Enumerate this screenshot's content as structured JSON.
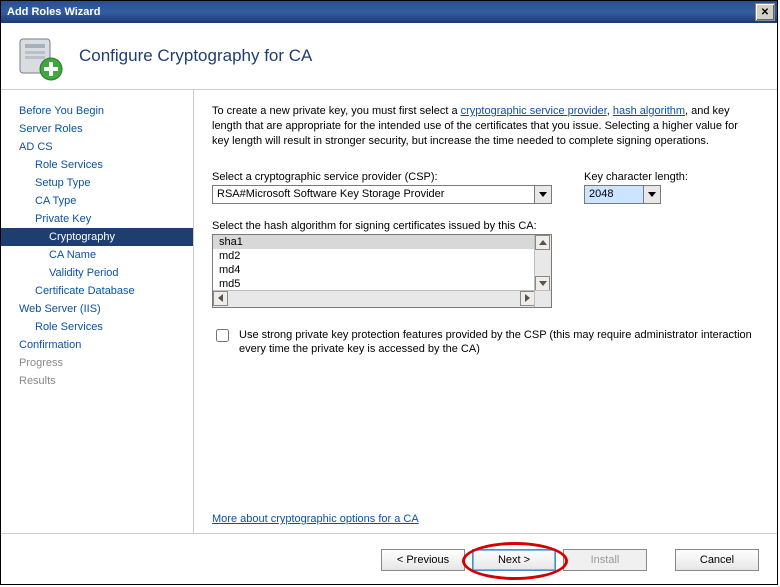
{
  "title": "Add Roles Wizard",
  "header": "Configure Cryptography for CA",
  "intro": {
    "p1a": "To create a new private key, you must first select a ",
    "link1": "cryptographic service provider",
    "p1b": ", ",
    "link2": "hash algorithm",
    "p1c": ", and key length that are appropriate for the intended use of the certificates that you issue. Selecting a higher value for key length will result in stronger security, but increase the time needed to complete signing operations."
  },
  "sidebar": [
    {
      "label": "Before You Begin",
      "cls": ""
    },
    {
      "label": "Server Roles",
      "cls": ""
    },
    {
      "label": "AD CS",
      "cls": ""
    },
    {
      "label": "Role Services",
      "cls": "sub"
    },
    {
      "label": "Setup Type",
      "cls": "sub"
    },
    {
      "label": "CA Type",
      "cls": "sub"
    },
    {
      "label": "Private Key",
      "cls": "sub"
    },
    {
      "label": "Cryptography",
      "cls": "subsub sel"
    },
    {
      "label": "CA Name",
      "cls": "subsub"
    },
    {
      "label": "Validity Period",
      "cls": "subsub"
    },
    {
      "label": "Certificate Database",
      "cls": "sub"
    },
    {
      "label": "Web Server (IIS)",
      "cls": ""
    },
    {
      "label": "Role Services",
      "cls": "sub"
    },
    {
      "label": "Confirmation",
      "cls": ""
    },
    {
      "label": "Progress",
      "cls": "dis"
    },
    {
      "label": "Results",
      "cls": "dis"
    }
  ],
  "csp": {
    "label": "Select a cryptographic service provider (CSP):",
    "value": "RSA#Microsoft Software Key Storage Provider"
  },
  "keylen": {
    "label": "Key character length:",
    "value": "2048"
  },
  "hash": {
    "label": "Select the hash algorithm for signing certificates issued by this CA:",
    "items": [
      "sha1",
      "md2",
      "md4",
      "md5"
    ]
  },
  "checkbox": {
    "label": "Use strong private key protection features provided by the CSP (this may require administrator interaction every time the private key is accessed by the CA)"
  },
  "learn_more": "More about cryptographic options for a CA",
  "buttons": {
    "previous": "< Previous",
    "next": "Next >",
    "install": "Install",
    "cancel": "Cancel"
  }
}
